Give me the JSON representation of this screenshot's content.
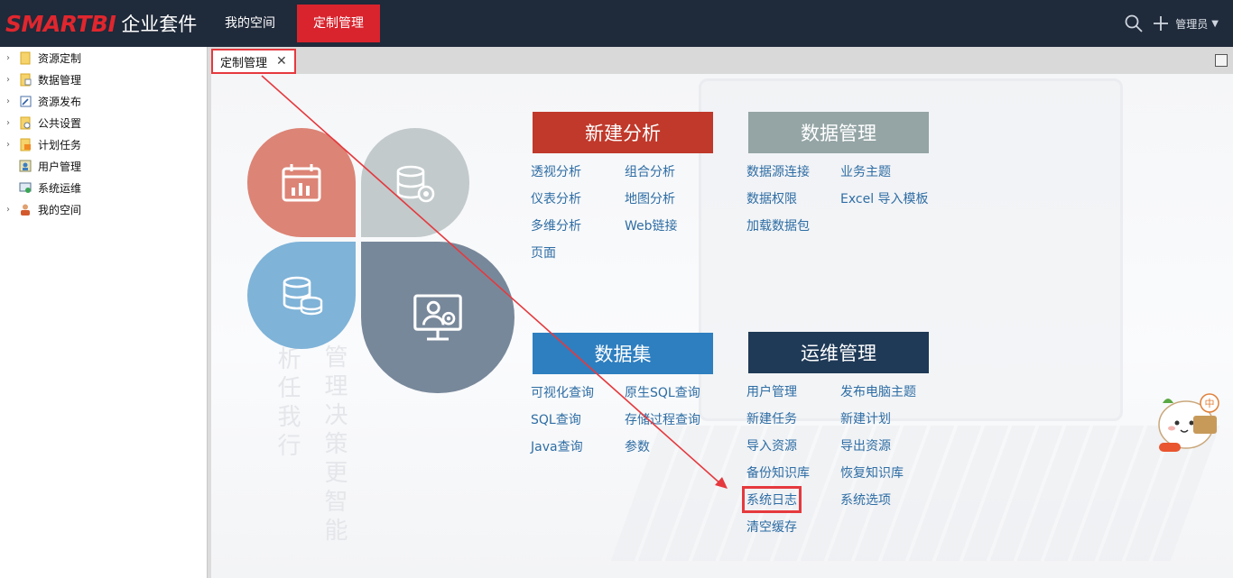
{
  "app": {
    "brand": "SMARTBI",
    "suite": "企业套件",
    "nav": [
      "我的空间",
      "定制管理"
    ],
    "active_nav": 1,
    "admin_label": "管理员"
  },
  "sidebar": {
    "items": [
      {
        "label": "资源定制",
        "icon": "folder-icon",
        "expandable": true
      },
      {
        "label": "数据管理",
        "icon": "data-folder-icon",
        "expandable": true
      },
      {
        "label": "资源发布",
        "icon": "publish-icon",
        "expandable": true
      },
      {
        "label": "公共设置",
        "icon": "settings-icon",
        "expandable": true
      },
      {
        "label": "计划任务",
        "icon": "schedule-icon",
        "expandable": true
      },
      {
        "label": "用户管理",
        "icon": "user-manage-icon",
        "expandable": false
      },
      {
        "label": "系统运维",
        "icon": "system-ops-icon",
        "expandable": false
      },
      {
        "label": "我的空间",
        "icon": "my-space-icon",
        "expandable": true
      }
    ]
  },
  "tabs": [
    {
      "label": "定制管理",
      "close": "✕"
    }
  ],
  "background": {
    "slogan_a": "分析任我行",
    "slogan_b": "管理决策更智能"
  },
  "sections": {
    "new_analysis": {
      "title": "新建分析",
      "color": "#c0392b",
      "links": [
        "透视分析",
        "组合分析",
        "仪表分析",
        "地图分析",
        "多维分析",
        "Web链接",
        "页面"
      ]
    },
    "data_manage": {
      "title": "数据管理",
      "color": "#95a5a6",
      "links": [
        "数据源连接",
        "业务主题",
        "数据权限",
        "Excel 导入模板",
        "加载数据包"
      ]
    },
    "dataset": {
      "title": "数据集",
      "color": "#2e7fc0",
      "links": [
        "可视化查询",
        "原生SQL查询",
        "SQL查询",
        "存储过程查询",
        "Java查询",
        "参数"
      ]
    },
    "ops": {
      "title": "运维管理",
      "color": "#1f3a57",
      "links": [
        "用户管理",
        "发布电脑主题",
        "新建任务",
        "新建计划",
        "导入资源",
        "导出资源",
        "备份知识库",
        "恢复知识库",
        "系统日志",
        "系统选项",
        "清空缓存"
      ]
    }
  },
  "flower": {
    "colors": [
      "#dc8476",
      "#c2cacc",
      "#7fb3d8",
      "#78889b"
    ],
    "icons": [
      "calendar-chart-icon",
      "database-gear-icon",
      "database-icon",
      "monitor-user-icon"
    ]
  },
  "accent": "#e5393e"
}
